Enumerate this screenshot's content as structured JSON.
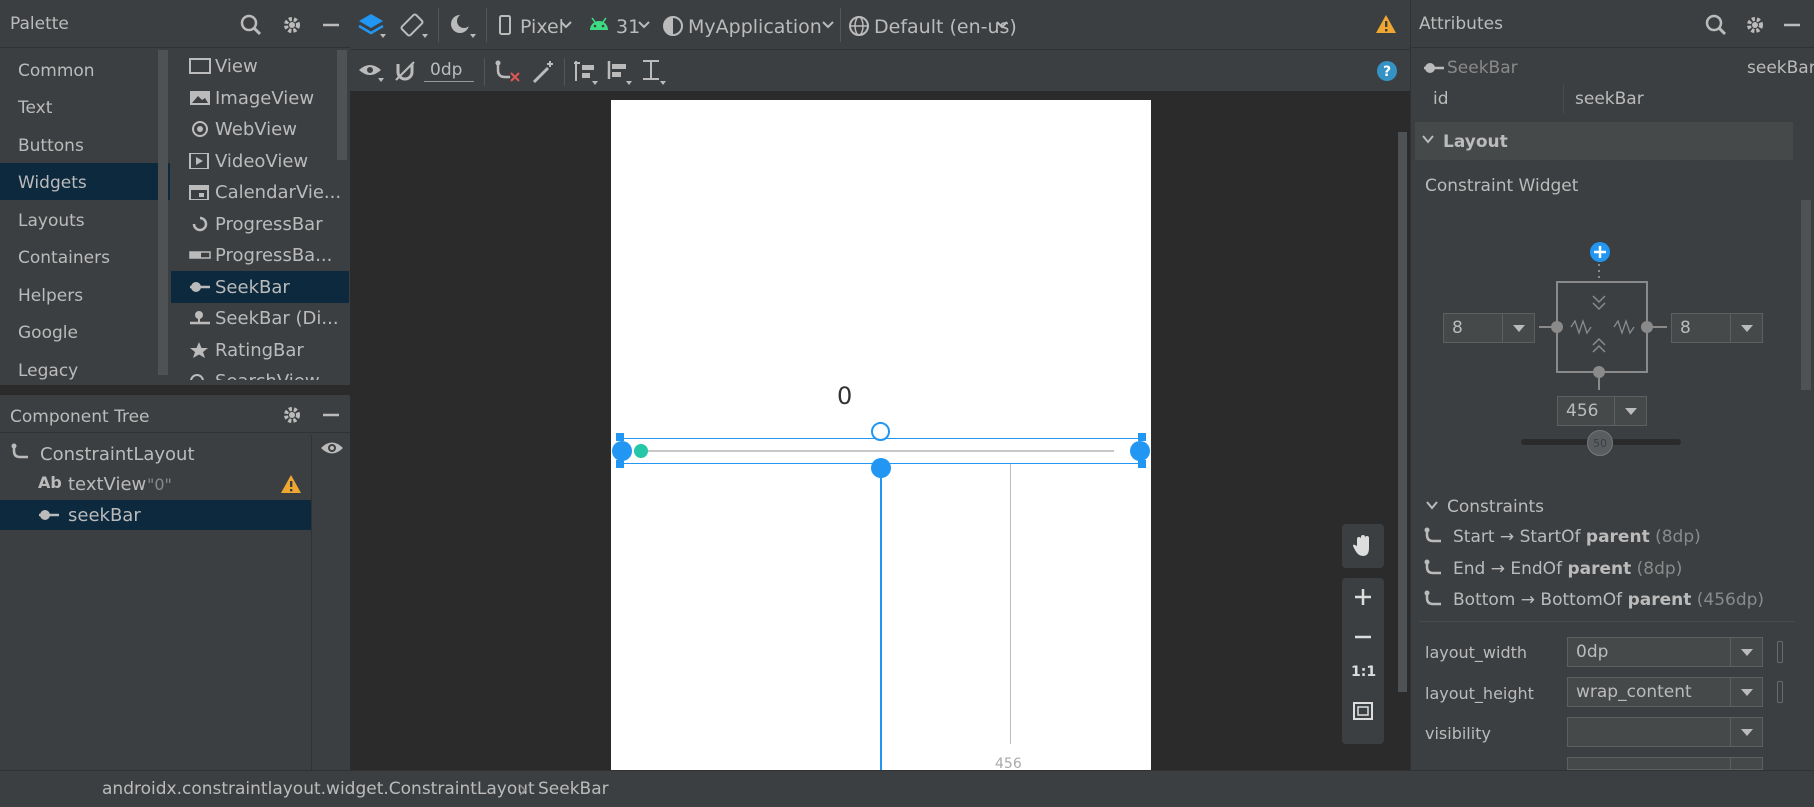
{
  "palette": {
    "title": "Palette",
    "categories": [
      "Common",
      "Text",
      "Buttons",
      "Widgets",
      "Layouts",
      "Containers",
      "Helpers",
      "Google",
      "Legacy"
    ],
    "selected_category": "Widgets",
    "widgets": [
      "View",
      "ImageView",
      "WebView",
      "VideoView",
      "CalendarVie...",
      "ProgressBar",
      "ProgressBa...",
      "SeekBar",
      "SeekBar (Di...",
      "RatingBar",
      "SearchView"
    ],
    "selected_widget": "SeekBar"
  },
  "component_tree": {
    "title": "Component Tree",
    "root": "ConstraintLayout",
    "children": [
      {
        "label": "textView",
        "value": "\"0\"",
        "warning": true
      },
      {
        "label": "seekBar",
        "selected": true
      }
    ]
  },
  "toolbar": {
    "device": "Pixel",
    "api": "31",
    "theme": "MyApplication",
    "locale": "Default (en-us)",
    "margin": "0dp"
  },
  "canvas": {
    "text_value": "0",
    "bottom_margin_label": "456"
  },
  "attributes": {
    "title": "Attributes",
    "widget_type": "SeekBar",
    "widget_id_display": "seekBar",
    "id_label": "id",
    "id_value": "seekBar",
    "layout_section": "Layout",
    "constraint_widget_label": "Constraint Widget",
    "left_margin": "8",
    "right_margin": "8",
    "bottom_margin": "456",
    "bias": "50",
    "constraints_section": "Constraints",
    "constraints": [
      {
        "a": "Start",
        "b": "StartOf",
        "target": "parent",
        "val": "(8dp)"
      },
      {
        "a": "End",
        "b": "EndOf",
        "target": "parent",
        "val": "(8dp)"
      },
      {
        "a": "Bottom",
        "b": "BottomOf",
        "target": "parent",
        "val": "(456dp)"
      }
    ],
    "layout_width_label": "layout_width",
    "layout_width": "0dp",
    "layout_height_label": "layout_height",
    "layout_height": "wrap_content",
    "visibility_label": "visibility",
    "visibility": ""
  },
  "status": {
    "path": "androidx.constraintlayout.widget.ConstraintLayout",
    "leaf": "SeekBar"
  },
  "colors": {
    "accent": "#2196f3",
    "warning": "#f0a732",
    "selection": "#0d293e"
  }
}
